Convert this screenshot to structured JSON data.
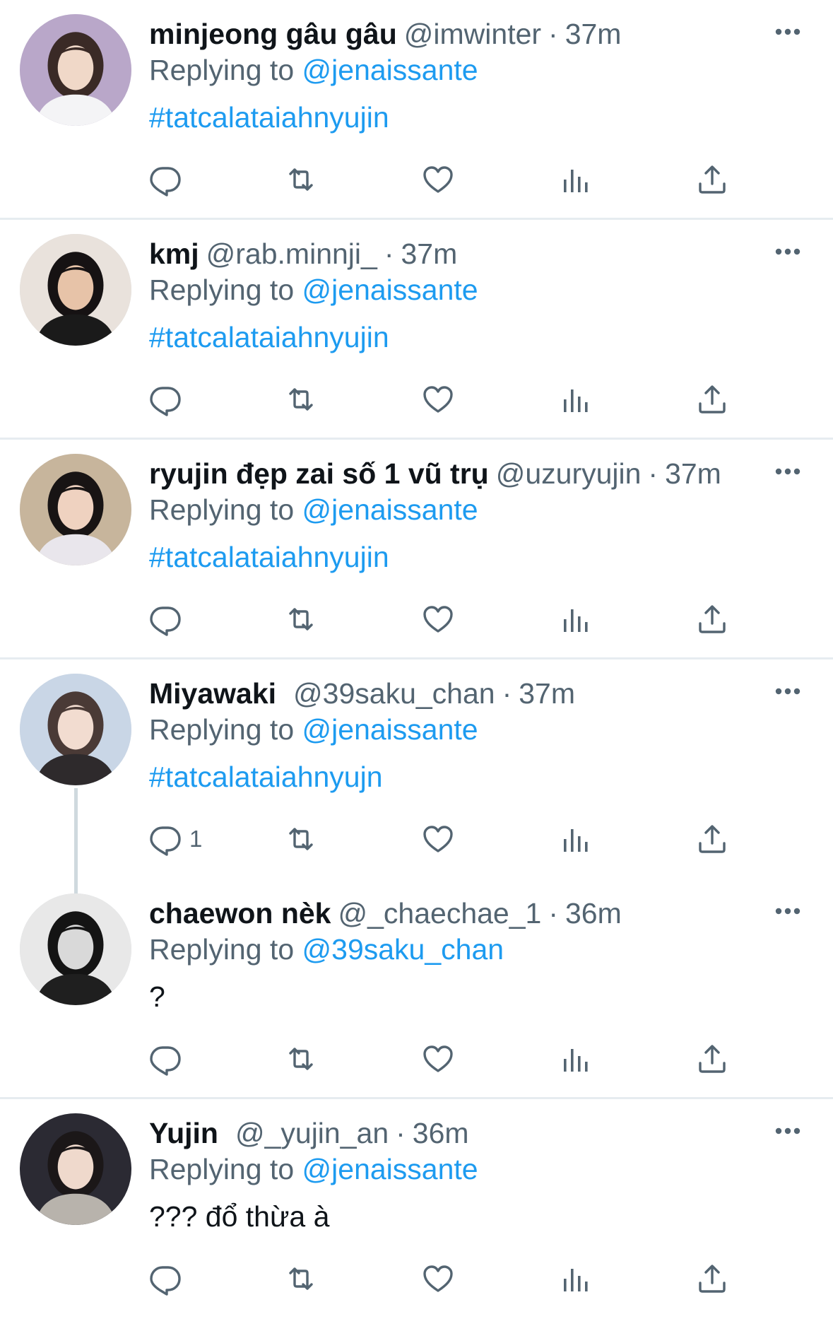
{
  "tweets": [
    {
      "display_name": "minjeong gâu gâu",
      "handle": "@imwinter",
      "separator": "·",
      "time": "37m",
      "replying_prefix": "Replying to",
      "replying_to": "@jenaissante",
      "text": "#tatcalataiahnyujin",
      "text_style": "hashtag",
      "reply_count": "",
      "avatar_colors": {
        "bg": "#b9a7c9",
        "skin": "#f0d8c8",
        "hair": "#3a2a26",
        "shirt": "#f4f4f6"
      }
    },
    {
      "display_name": "kmj",
      "handle": "@rab.minnji_",
      "separator": "·",
      "time": "37m",
      "replying_prefix": "Replying to",
      "replying_to": "@jenaissante",
      "text": "#tatcalataiahnyujin",
      "text_style": "hashtag",
      "reply_count": "",
      "avatar_colors": {
        "bg": "#e9e2dc",
        "skin": "#e7c3a8",
        "hair": "#161213",
        "shirt": "#1a1a1a"
      }
    },
    {
      "display_name": "ryujin đẹp zai số 1 vũ trụ",
      "handle": "@uzuryujin",
      "separator": "·",
      "time": "37m",
      "replying_prefix": "Replying to",
      "replying_to": "@jenaissante",
      "text": "#tatcalataiahnyujin",
      "text_style": "hashtag",
      "reply_count": "",
      "avatar_colors": {
        "bg": "#c7b59c",
        "skin": "#efd2c0",
        "hair": "#181414",
        "shirt": "#e9e6ec"
      }
    },
    {
      "display_name": "Miyawaki",
      "handle": "@39saku_chan",
      "separator": "·",
      "time": "37m",
      "replying_prefix": "Replying to",
      "replying_to": "@jenaissante",
      "text": "#tatcalataiahnyujn",
      "text_style": "hashtag",
      "reply_count": "1",
      "avatar_colors": {
        "bg": "#c9d6e6",
        "skin": "#f2dcd0",
        "hair": "#4a3a36",
        "shirt": "#2e2a2c"
      }
    },
    {
      "display_name": "chaewon nèk",
      "handle": "@_chaechae_1",
      "separator": "·",
      "time": "36m",
      "replying_prefix": "Replying to",
      "replying_to": "@39saku_chan",
      "text": "?",
      "text_style": "plain",
      "reply_count": "",
      "avatar_colors": {
        "bg": "#e8e8e8",
        "skin": "#d9d9d9",
        "hair": "#141414",
        "shirt": "#1f1f1f"
      }
    },
    {
      "display_name": "Yujin",
      "handle": "@_yujin_an",
      "separator": "·",
      "time": "36m",
      "replying_prefix": "Replying to",
      "replying_to": "@jenaissante",
      "text": "??? đổ thừa à",
      "text_style": "plain",
      "reply_count": "",
      "avatar_colors": {
        "bg": "#2b2a33",
        "skin": "#efd9cc",
        "hair": "#1b1718",
        "shirt": "#b8b3ac"
      }
    }
  ],
  "icons": {
    "reply": "reply-icon",
    "retweet": "retweet-icon",
    "like": "like-icon",
    "stats": "stats-icon",
    "share": "share-icon",
    "more": "more-icon"
  },
  "colors": {
    "link": "#1d9bf0",
    "muted": "#536471",
    "text": "#0f1419",
    "divider": "#e6ecf0",
    "thread_line": "#cfd9de"
  }
}
